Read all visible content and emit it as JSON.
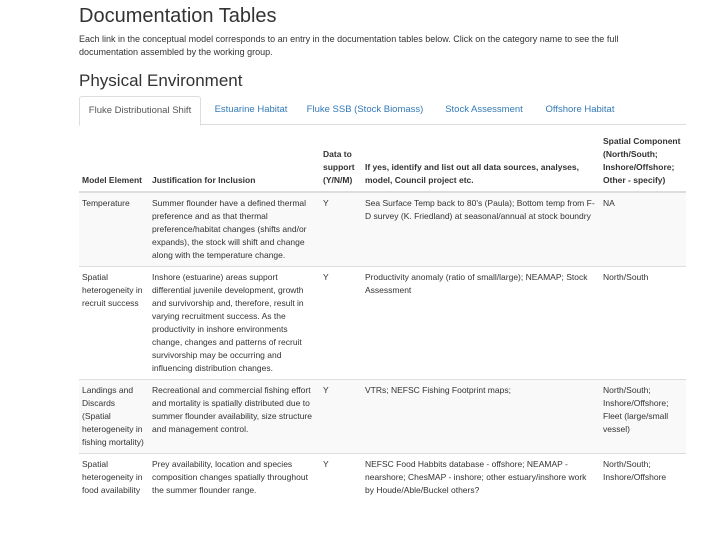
{
  "page": {
    "title": "Documentation Tables",
    "intro": "Each link in the conceptual model corresponds to an entry in the documentation tables below. Click on the category name to see the full documentation assembled by the working group.",
    "section_title": "Physical Environment"
  },
  "tabs": [
    {
      "label": "Fluke Distributional Shift",
      "active": true
    },
    {
      "label": "Estuarine Habitat",
      "active": false
    },
    {
      "label": "Fluke SSB (Stock Biomass)",
      "active": false
    },
    {
      "label": "Stock Assessment",
      "active": false
    },
    {
      "label": "Offshore Habitat",
      "active": false
    }
  ],
  "table": {
    "headers": {
      "element": "Model Element",
      "justification": "Justification for Inclusion",
      "support": "Data to support (Y/N/M)",
      "sources": "If yes, identify and list out all data sources, analyses, model, Council project etc.",
      "spatial": "Spatial Component (North/South; Inshore/Offshore; Other - specify)"
    },
    "rows": [
      {
        "element": "Temperature",
        "justification": "Summer flounder have a defined thermal preference and as that thermal preference/habitat changes (shifts and/or expands), the stock will shift and change along with the temperature change.",
        "support": "Y",
        "sources": "Sea Surface Temp back to 80's (Paula); Bottom temp from F-D survey (K. Friedland) at seasonal/annual at stock boundry",
        "spatial": "NA"
      },
      {
        "element": "Spatial heterogeneity in recruit success",
        "justification": "Inshore (estuarine) areas support differential juvenile development, growth and survivorship and, therefore, result in varying recruitment success. As the productivity in inshore environments change, changes and patterns of recruit survivorship may be occurring and influencing distribution changes.",
        "support": "Y",
        "sources": "Productivity anomaly (ratio of small/large); NEAMAP; Stock Assessment",
        "spatial": "North/South"
      },
      {
        "element": "Landings and Discards (Spatial heterogeneity in fishing mortality)",
        "justification": "Recreational and commercial fishing effort and mortality is spatially distributed due to summer flounder availability, size structure and management control.",
        "support": "Y",
        "sources": "VTRs; NEFSC Fishing Footprint maps;",
        "spatial": "North/South; Inshore/Offshore; Fleet (large/small vessel)"
      },
      {
        "element": "Spatial heterogeneity in food availability",
        "justification": "Prey availability, location and species composition changes spatially throughout the summer flounder range.",
        "support": "Y",
        "sources": "NEFSC Food Habbits database - offshore; NEAMAP - nearshore; ChesMAP - inshore; other estuary/inshore work by Houde/Able/Buckel others?",
        "spatial": "North/South; Inshore/Offshore"
      }
    ]
  }
}
